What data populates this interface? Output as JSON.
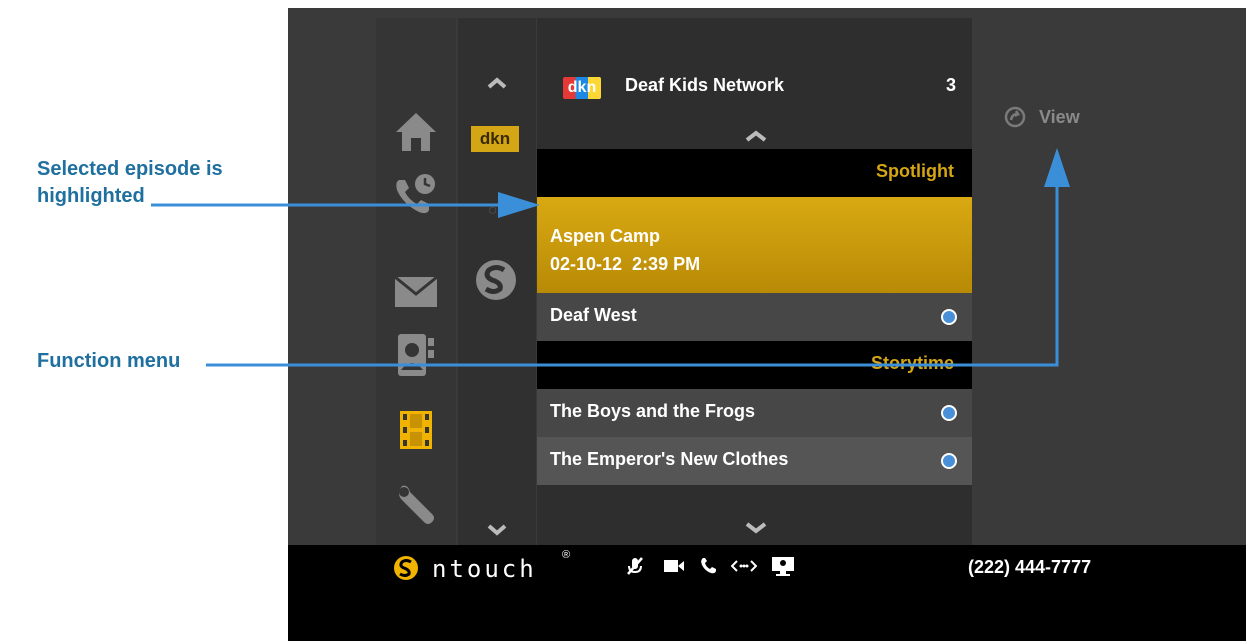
{
  "annotations": {
    "selected_line1": "Selected episode is",
    "selected_line2": "highlighted",
    "function_menu": "Function menu"
  },
  "channel": {
    "logo_text": "dkn",
    "name": "Deaf Kids Network",
    "count": "3"
  },
  "sidebar": {
    "items": [
      "home-icon",
      "call-history-icon",
      "mail-icon",
      "contacts-icon",
      "video-center-icon",
      "settings-icon"
    ],
    "selected": "video-center-icon"
  },
  "channels": {
    "dkn_label": "dkn",
    "second_label": "○S"
  },
  "list": {
    "section1": "Spotlight",
    "selected_title": "Aspen Camp",
    "selected_date": "02-10-12  2:39 PM",
    "item_deaf_west": "Deaf West",
    "section2": "Storytime",
    "item_boys_frogs": "The Boys and the Frogs",
    "item_emperor": "The Emperor's New Clothes"
  },
  "function_menu": {
    "view_label": "View"
  },
  "bottom_bar": {
    "brand": "ntouch",
    "brand_mark": "®",
    "phone_number": "(222) 444-7777",
    "status_icons": [
      "mic-muted-icon",
      "video-camera-icon",
      "phone-icon",
      "relay-icon",
      "screen-share-icon"
    ]
  },
  "colors": {
    "accent": "#d4a514",
    "highlight": "#c99a0c",
    "annotation": "#1f6f9f",
    "arrow": "#3b8fd8",
    "status_dot": "#4a90d9"
  }
}
